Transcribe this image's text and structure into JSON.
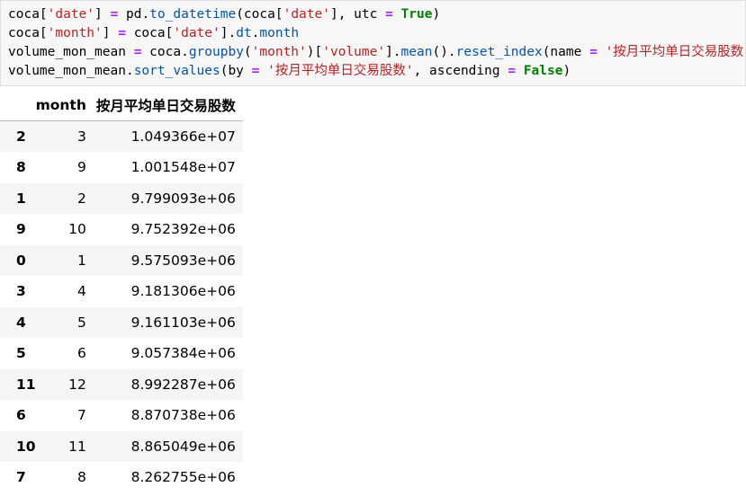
{
  "code_cell": {
    "lines": [
      [
        {
          "t": "coca[",
          "c": ""
        },
        {
          "t": "'date'",
          "c": "s"
        },
        {
          "t": "] ",
          "c": ""
        },
        {
          "t": "=",
          "c": "o"
        },
        {
          "t": " pd.",
          "c": ""
        },
        {
          "t": "to_datetime",
          "c": "m"
        },
        {
          "t": "(coca[",
          "c": ""
        },
        {
          "t": "'date'",
          "c": "s"
        },
        {
          "t": "], utc ",
          "c": ""
        },
        {
          "t": "=",
          "c": "o"
        },
        {
          "t": " ",
          "c": ""
        },
        {
          "t": "True",
          "c": "k"
        },
        {
          "t": ")",
          "c": ""
        }
      ],
      [
        {
          "t": "coca[",
          "c": ""
        },
        {
          "t": "'month'",
          "c": "s"
        },
        {
          "t": "] ",
          "c": ""
        },
        {
          "t": "=",
          "c": "o"
        },
        {
          "t": " coca[",
          "c": ""
        },
        {
          "t": "'date'",
          "c": "s"
        },
        {
          "t": "].",
          "c": ""
        },
        {
          "t": "dt",
          "c": "m"
        },
        {
          "t": ".",
          "c": ""
        },
        {
          "t": "month",
          "c": "m"
        }
      ],
      [
        {
          "t": "volume_mon_mean ",
          "c": ""
        },
        {
          "t": "=",
          "c": "o"
        },
        {
          "t": " coca.",
          "c": ""
        },
        {
          "t": "groupby",
          "c": "m"
        },
        {
          "t": "(",
          "c": ""
        },
        {
          "t": "'month'",
          "c": "s"
        },
        {
          "t": ")[",
          "c": ""
        },
        {
          "t": "'volume'",
          "c": "s"
        },
        {
          "t": "].",
          "c": ""
        },
        {
          "t": "mean",
          "c": "m"
        },
        {
          "t": "().",
          "c": ""
        },
        {
          "t": "reset_index",
          "c": "m"
        },
        {
          "t": "(name ",
          "c": ""
        },
        {
          "t": "=",
          "c": "o"
        },
        {
          "t": " ",
          "c": ""
        },
        {
          "t": "'按月平均单日交易股数'",
          "c": "s"
        },
        {
          "t": ")",
          "c": ""
        }
      ],
      [
        {
          "t": "volume_mon_mean.",
          "c": ""
        },
        {
          "t": "sort_values",
          "c": "m"
        },
        {
          "t": "(by ",
          "c": ""
        },
        {
          "t": "=",
          "c": "o"
        },
        {
          "t": " ",
          "c": ""
        },
        {
          "t": "'按月平均单日交易股数'",
          "c": "s"
        },
        {
          "t": ", ascending ",
          "c": ""
        },
        {
          "t": "=",
          "c": "o"
        },
        {
          "t": " ",
          "c": ""
        },
        {
          "t": "False",
          "c": "k"
        },
        {
          "t": ")",
          "c": ""
        }
      ]
    ]
  },
  "output_table": {
    "index_header": "",
    "headers": [
      "month",
      "按月平均单日交易股数"
    ],
    "rows": [
      {
        "index": "2",
        "month": "3",
        "value": "1.049366e+07"
      },
      {
        "index": "8",
        "month": "9",
        "value": "1.001548e+07"
      },
      {
        "index": "1",
        "month": "2",
        "value": "9.799093e+06"
      },
      {
        "index": "9",
        "month": "10",
        "value": "9.752392e+06"
      },
      {
        "index": "0",
        "month": "1",
        "value": "9.575093e+06"
      },
      {
        "index": "3",
        "month": "4",
        "value": "9.181306e+06"
      },
      {
        "index": "4",
        "month": "5",
        "value": "9.161103e+06"
      },
      {
        "index": "5",
        "month": "6",
        "value": "9.057384e+06"
      },
      {
        "index": "11",
        "month": "12",
        "value": "8.992287e+06"
      },
      {
        "index": "6",
        "month": "7",
        "value": "8.870738e+06"
      },
      {
        "index": "10",
        "month": "11",
        "value": "8.865049e+06"
      },
      {
        "index": "7",
        "month": "8",
        "value": "8.262755e+06"
      }
    ]
  },
  "colors": {
    "string": "#ba2121",
    "operator": "#aa22ff",
    "keyword": "#008000",
    "method": "#0055aa",
    "cell_background": "#f7f7f7",
    "row_stripe": "#f5f5f5"
  }
}
